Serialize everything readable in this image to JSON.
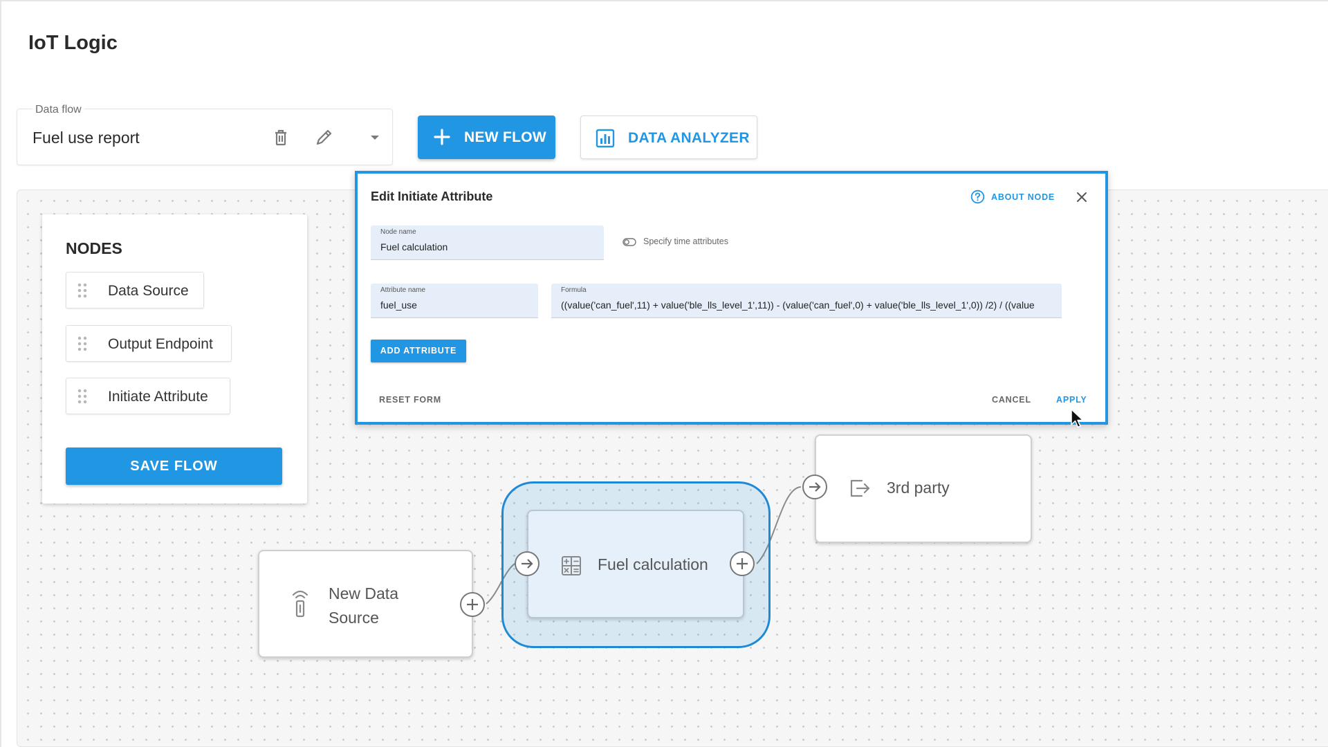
{
  "app": {
    "title": "IoT Logic"
  },
  "flow_select": {
    "label": "Data flow",
    "value": "Fuel use report",
    "icons": [
      "trash-icon",
      "pencil-icon",
      "chevron-down-icon"
    ]
  },
  "toolbar": {
    "new_flow_label": "NEW FLOW",
    "data_analyzer_label": "DATA ANALYZER"
  },
  "nodes_panel": {
    "title": "NODES",
    "items": [
      {
        "label": "Data Source"
      },
      {
        "label": "Output Endpoint"
      },
      {
        "label": "Initiate Attribute"
      }
    ],
    "save_label": "SAVE FLOW"
  },
  "flow_nodes": {
    "data_source": {
      "label": "New Data Source",
      "icon": "antenna-icon"
    },
    "fuel_calculation": {
      "label": "Fuel calculation",
      "icon": "calculator-icon",
      "selected": true
    },
    "third_party": {
      "label": "3rd party",
      "icon": "export-icon"
    }
  },
  "dialog": {
    "title": "Edit Initiate Attribute",
    "about_label": "ABOUT NODE",
    "node_name": {
      "label": "Node name",
      "value": "Fuel calculation"
    },
    "time_toggle_label": "Specify time attributes",
    "attribute_name": {
      "label": "Attribute name",
      "value": "fuel_use"
    },
    "formula": {
      "label": "Formula",
      "value": "((value('can_fuel',11) + value('ble_lls_level_1',11)) - (value('can_fuel',0) + value('ble_lls_level_1',0)) /2) / ((value"
    },
    "add_attribute_label": "ADD ATTRIBUTE",
    "reset_label": "RESET FORM",
    "cancel_label": "CANCEL",
    "apply_label": "APPLY"
  },
  "colors": {
    "accent": "#2196e3",
    "selection_fill": "#e6f0fa",
    "field_bg": "#e6eef9"
  }
}
